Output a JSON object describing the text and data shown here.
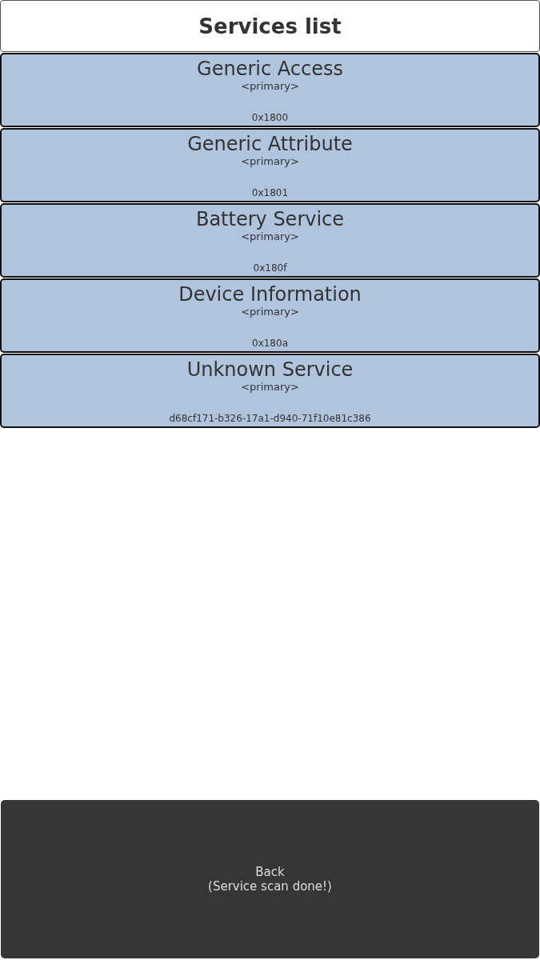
{
  "header": {
    "title": "Services list"
  },
  "services": [
    {
      "name": "Generic Access",
      "type": "<primary>",
      "uuid": "0x1800"
    },
    {
      "name": "Generic Attribute",
      "type": "<primary>",
      "uuid": "0x1801"
    },
    {
      "name": "Battery Service",
      "type": "<primary>",
      "uuid": "0x180f"
    },
    {
      "name": "Device Information",
      "type": "<primary>",
      "uuid": "0x180a"
    },
    {
      "name": "Unknown Service",
      "type": "<primary>",
      "uuid": "d68cf171-b326-17a1-d940-71f10e81c386"
    }
  ],
  "back_button": {
    "label": "Back",
    "status": "(Service scan done!)"
  }
}
